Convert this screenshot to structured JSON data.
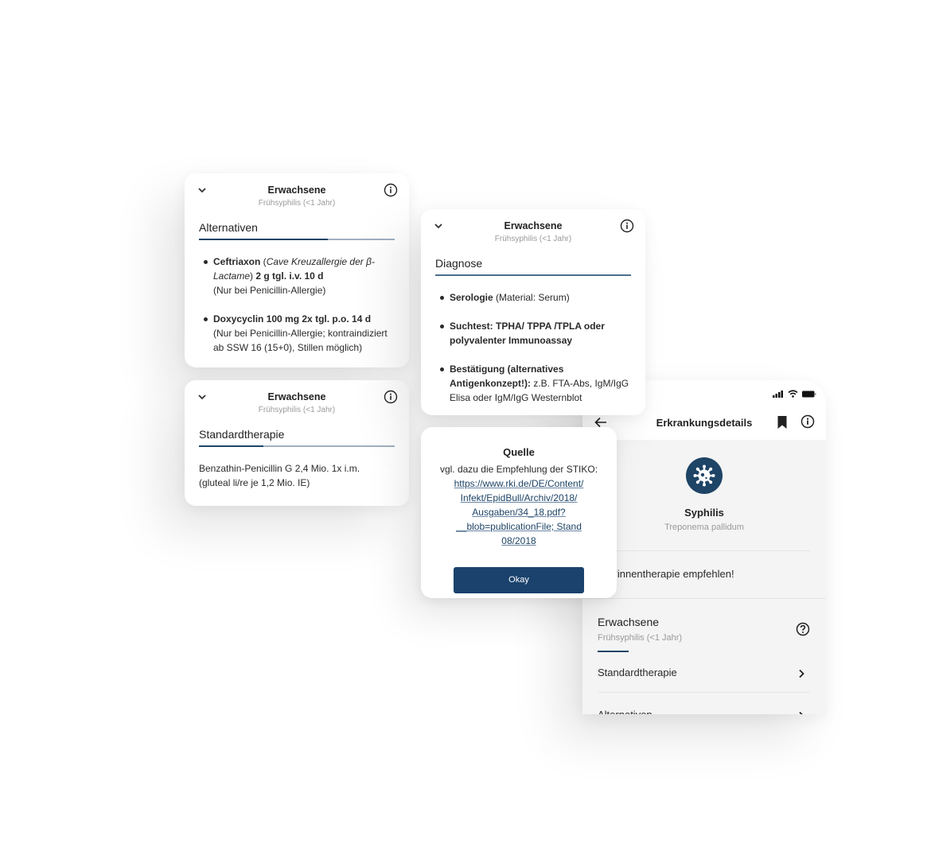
{
  "colors": {
    "primary": "#1e4466",
    "button": "#1a426c",
    "muted_text": "#9a9a9a",
    "phone_bg": "#f4f4f4"
  },
  "card_alternativen": {
    "header_title": "Erwachsene",
    "header_subtitle": "Frühsyphilis (<1 Jahr)",
    "section_title": "Alternativen",
    "tab_progress_percent": 66,
    "items": [
      {
        "bold": "Ceftriaxon",
        "open_paren": " (",
        "italic": "Cave Kreuzallergie der β-Lactame",
        "close_paren": ") ",
        "bold2": " 2 g tgl. i.v. 10 d",
        "note": "(Nur bei Penicillin-Allergie)"
      },
      {
        "bold": "Doxycyclin 100 mg 2x tgl. p.o. 14 d",
        "note": "(Nur bei Penicillin-Allergie; kontraindiziert ab SSW 16 (15+0), Stillen möglich)"
      }
    ]
  },
  "card_standard": {
    "header_title": "Erwachsene",
    "header_subtitle": "Frühsyphilis (<1 Jahr)",
    "section_title": "Standardtherapie",
    "tab_progress_percent": 33,
    "text": "Benzathin-Penicillin G 2,4 Mio. 1x i.m. (gluteal li/re je 1,2 Mio. IE)"
  },
  "card_diagnose": {
    "header_title": "Erwachsene",
    "header_subtitle": "Frühsyphilis (<1 Jahr)",
    "section_title": "Diagnose",
    "tab_progress_percent": 100,
    "items": [
      {
        "bold": "Serologie",
        "rest": " (Material: Serum)"
      },
      {
        "bold": "Suchtest: TPHA/ TPPA /TPLA oder polyvalenter Immunoassay",
        "rest": ""
      },
      {
        "bold": "Bestätigung (alternatives Antigenkonzept!):",
        "rest": " z.B. FTA-Abs, IgM/IgG Elisa oder IgM/IgG Westernblot"
      }
    ]
  },
  "dialog_quelle": {
    "title": "Quelle",
    "text": "vgl. dazu die Empfehlung der STIKO:",
    "link_lines": [
      "https://www.rki.de/DE/Content/",
      "Infekt/EpidBull/Archiv/2018/",
      "Ausgaben/34_18.pdf?",
      "__blob=publicationFile; Stand",
      "08/2018"
    ],
    "button_label": "Okay"
  },
  "phone": {
    "nav_title": "Erkrankungsdetails",
    "icons": {
      "back": "arrow-left-icon",
      "bookmark": "bookmark-icon",
      "info": "info-icon",
      "virus": "virus-icon",
      "help": "help-circle-icon",
      "chevron": "chevron-right-icon"
    },
    "disease_name": "Syphilis",
    "disease_latin": "Treponema pallidum",
    "partner_text": "ner*innentherapie empfehlen!",
    "group_title": "Erwachsene",
    "group_subtitle": "Frühsyphilis (<1 Jahr)",
    "rows": [
      {
        "label": "Standardtherapie"
      },
      {
        "label": "Alternativen"
      }
    ]
  }
}
